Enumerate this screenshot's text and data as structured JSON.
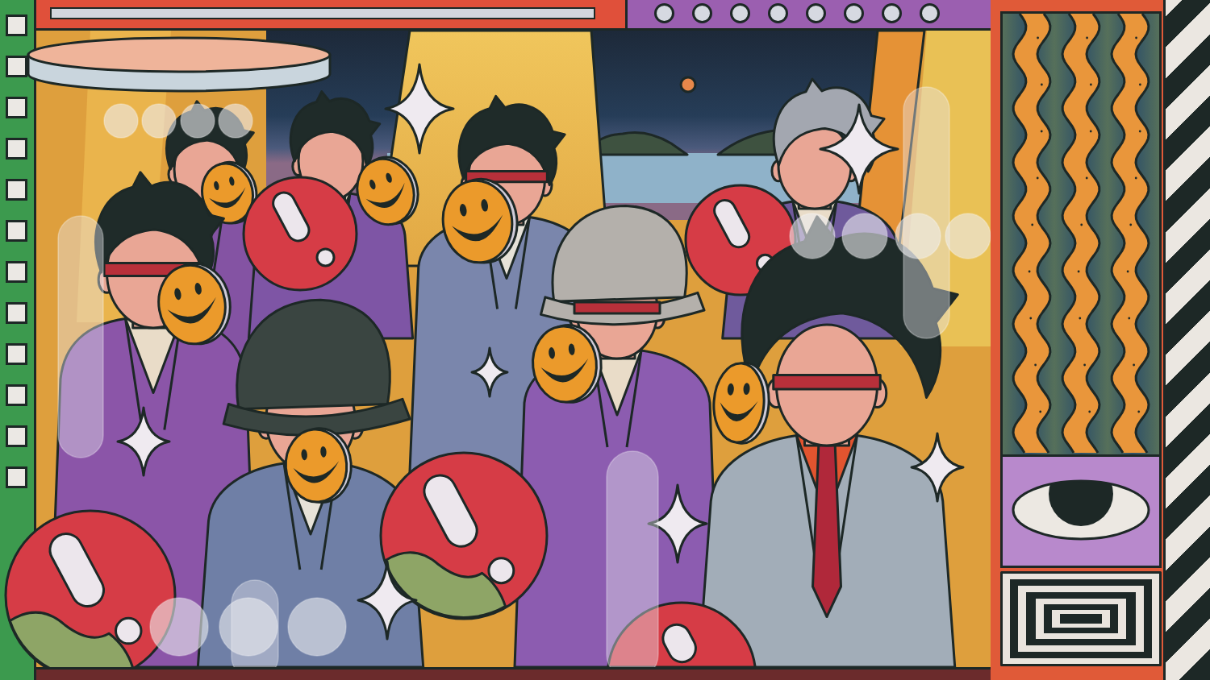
{
  "left_strip": {
    "holes": [
      {
        "kind": "square"
      },
      {
        "kind": "square"
      },
      {
        "kind": "square"
      },
      {
        "kind": "square"
      },
      {
        "kind": "square"
      },
      {
        "kind": "square"
      },
      {
        "kind": "square"
      },
      {
        "kind": "square"
      },
      {
        "kind": "square"
      },
      {
        "kind": "square"
      },
      {
        "kind": "square"
      },
      {
        "kind": "square"
      }
    ]
  },
  "top_bar": {
    "slot": {
      "kind": "groove"
    },
    "lights": [
      {
        "kind": "round"
      },
      {
        "kind": "round"
      },
      {
        "kind": "round"
      },
      {
        "kind": "round"
      },
      {
        "kind": "round"
      },
      {
        "kind": "round"
      },
      {
        "kind": "round"
      },
      {
        "kind": "round"
      }
    ]
  },
  "scene": {
    "figures": [
      {
        "kind": "person"
      },
      {
        "kind": "smiley"
      },
      {
        "kind": "person"
      },
      {
        "kind": "smiley"
      },
      {
        "kind": "greyhaired"
      },
      {
        "kind": "person"
      },
      {
        "kind": "smiley"
      },
      {
        "kind": "warning"
      },
      {
        "kind": "warning"
      },
      {
        "kind": "person"
      },
      {
        "kind": "smiley"
      },
      {
        "kind": "capped"
      },
      {
        "kind": "smiley"
      },
      {
        "kind": "capped"
      },
      {
        "kind": "smiley"
      },
      {
        "kind": "person"
      },
      {
        "kind": "smiley"
      },
      {
        "kind": "warning"
      },
      {
        "kind": "warning"
      },
      {
        "kind": "warning"
      }
    ],
    "sparkles": [
      {
        "kind": "star"
      },
      {
        "kind": "star"
      },
      {
        "kind": "star"
      },
      {
        "kind": "star"
      },
      {
        "kind": "star"
      },
      {
        "kind": "star"
      },
      {
        "kind": "star"
      }
    ],
    "glass": [
      {
        "kind": "circle"
      },
      {
        "kind": "circle"
      },
      {
        "kind": "circle"
      },
      {
        "kind": "circle"
      },
      {
        "kind": "pill"
      },
      {
        "kind": "pill"
      },
      {
        "kind": "circle"
      },
      {
        "kind": "circle"
      },
      {
        "kind": "circle"
      },
      {
        "kind": "circle"
      },
      {
        "kind": "pill"
      },
      {
        "kind": "pill"
      },
      {
        "kind": "circle"
      },
      {
        "kind": "circle"
      },
      {
        "kind": "circle"
      }
    ]
  },
  "side_panel": {
    "tiles": [
      {
        "kind": "waves"
      },
      {
        "kind": "eye"
      },
      {
        "kind": "squares"
      }
    ]
  },
  "right_strip": {
    "kind": "stripes"
  }
}
